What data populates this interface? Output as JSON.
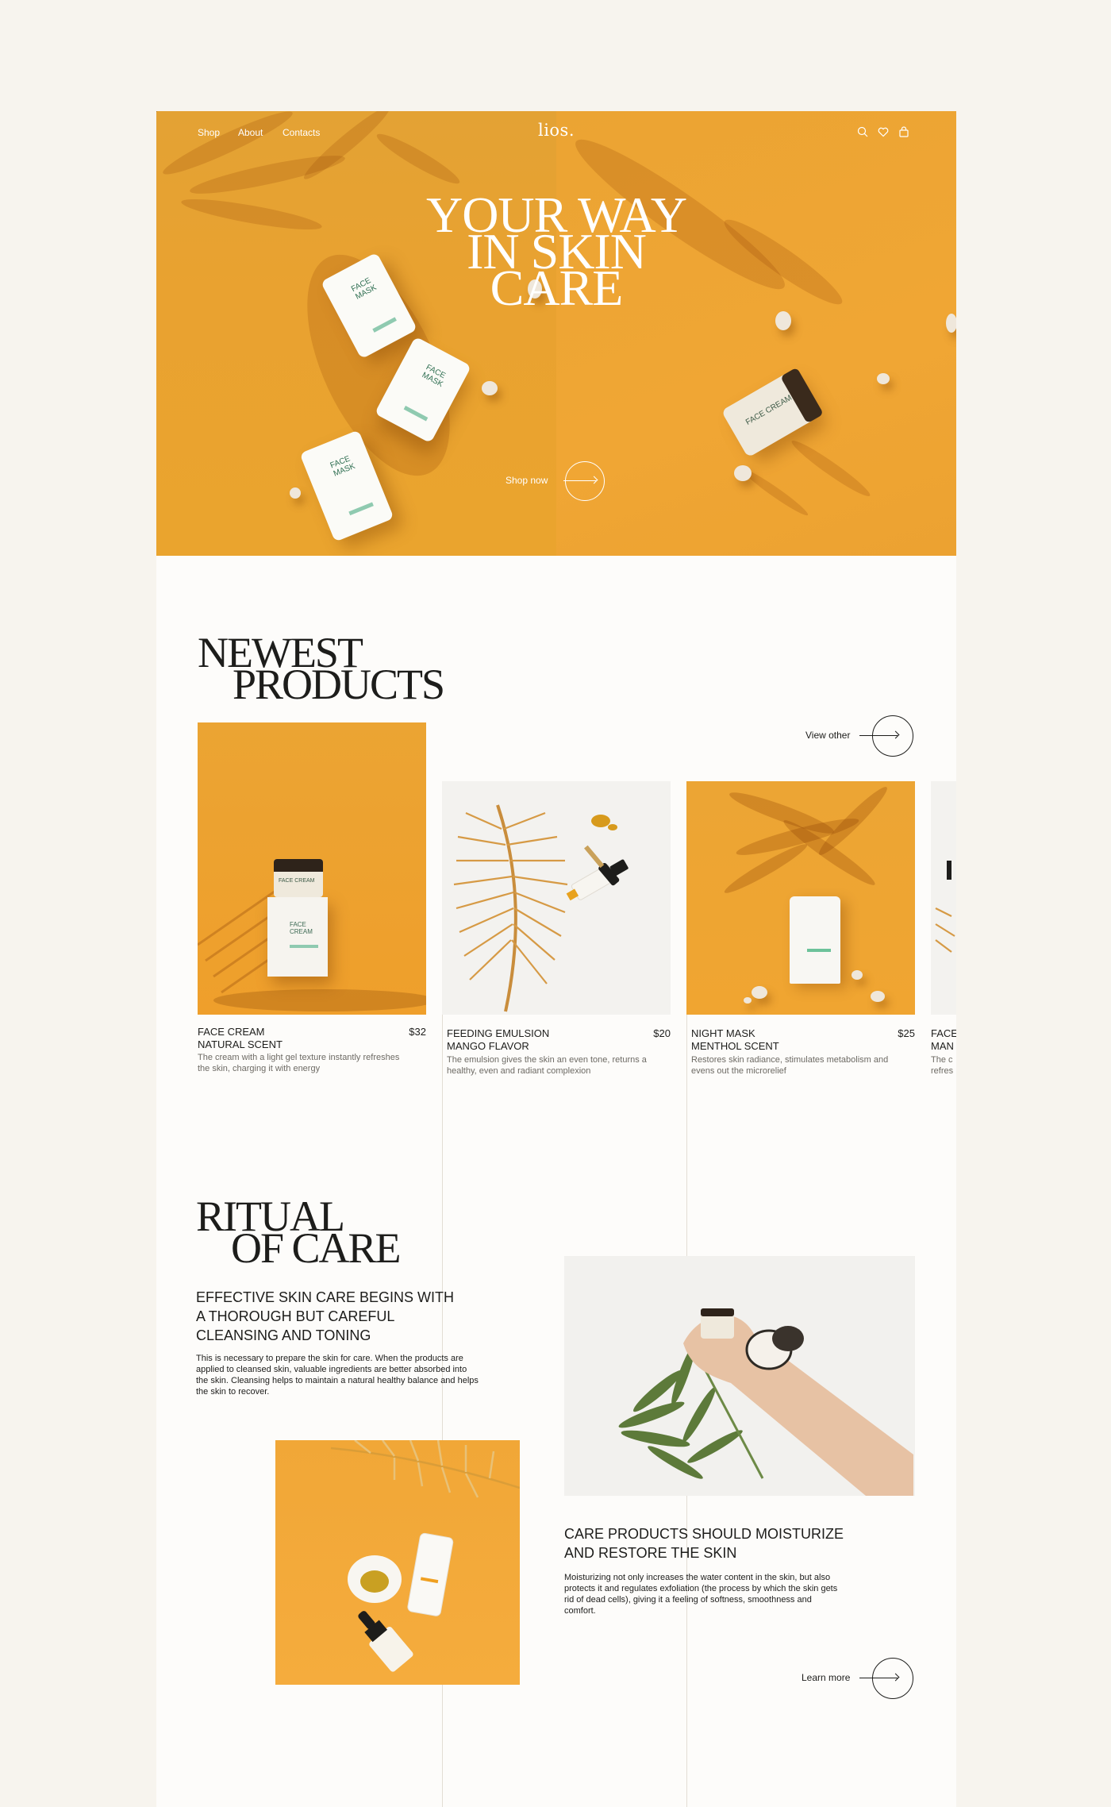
{
  "nav": {
    "links": [
      "Shop",
      "About",
      "Contacts"
    ],
    "logo": "lios.",
    "icons": [
      "search-icon",
      "heart-icon",
      "bag-icon"
    ]
  },
  "hero": {
    "title_lines": [
      "YOUR WAY",
      "IN SKIN",
      "CARE"
    ],
    "cta_label": "Shop now",
    "product_labels": [
      "FACE\nMASK",
      "FACE\nMASK",
      "FACE\nMASK",
      "FACE CREAM"
    ]
  },
  "newest": {
    "title_line1": "NEWEST",
    "title_line2": "PRODUCTS",
    "view_other_label": "View other",
    "products": [
      {
        "name": "FACE CREAM\nNATURAL SCENT",
        "price": "$32",
        "desc": "The cream with a light gel texture instantly refreshes the skin, charging it with energy"
      },
      {
        "name": "FEEDING EMULSION\nMANGO FLAVOR",
        "price": "$20",
        "desc": "The emulsion gives the skin an even tone, returns a healthy, even and radiant complexion"
      },
      {
        "name": "NIGHT MASK\nMENTHOL SCENT",
        "price": "$25",
        "desc": "Restores skin radiance, stimulates metabolism and evens out the microrelief"
      },
      {
        "name": "FACE\nMAN",
        "price": "",
        "desc": "The c\nrefres"
      }
    ],
    "product_jar_labels": [
      "FACE CREAM",
      "FACE\nCREAM"
    ]
  },
  "ritual": {
    "title_line1": "RITUAL",
    "title_line2": "OF CARE",
    "block1_heading": "EFFECTIVE SKIN CARE BEGINS WITH A THOROUGH BUT CAREFUL CLEANSING AND TONING",
    "block1_text": "This is necessary to prepare the skin for care. When the products are applied to cleansed skin, valuable ingredients are better absorbed into the skin. Cleansing helps to maintain a natural healthy balance and helps the skin to recover.",
    "block2_heading": "CARE PRODUCTS SHOULD MOISTURIZE AND RESTORE THE SKIN",
    "block2_text": "Moisturizing not only increases the water content in the skin, but also protects it and regulates exfoliation (the process by which the skin gets rid of dead cells), giving it a feeling of softness, smoothness and comfort.",
    "learn_more_label": "Learn more"
  },
  "colors": {
    "page_bg": "#f7f4ee",
    "content_bg": "#fdfcfa",
    "accent_orange": "#eaa42e",
    "text_dark": "#1d1d1b",
    "text_muted": "#6d6a64"
  }
}
